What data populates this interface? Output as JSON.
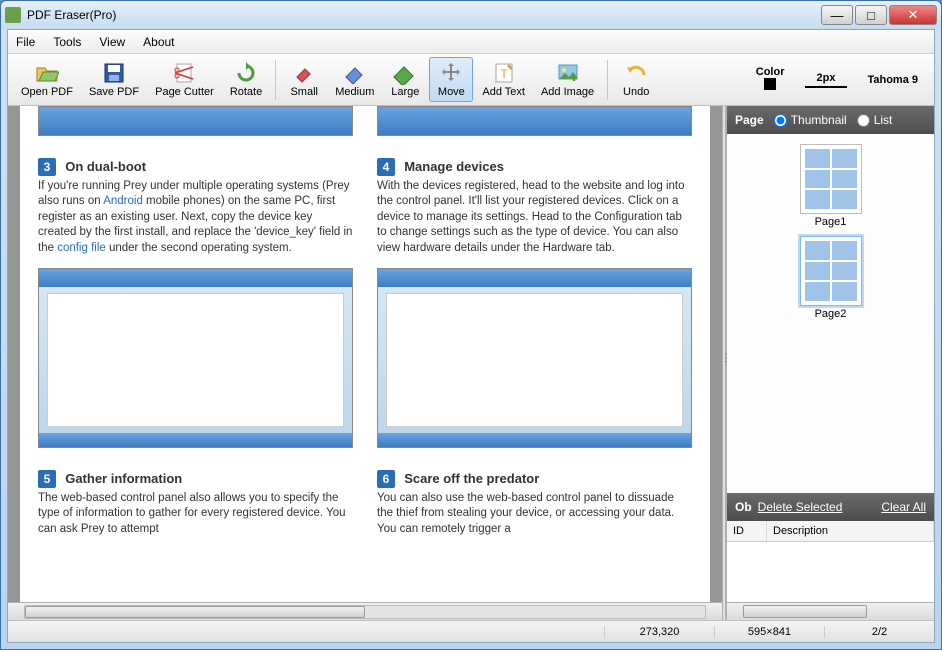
{
  "titlebar": {
    "title": "PDF Eraser(Pro)"
  },
  "menu": {
    "file": "File",
    "tools": "Tools",
    "view": "View",
    "about": "About"
  },
  "toolbar": {
    "open": "Open PDF",
    "save": "Save PDF",
    "cutter": "Page Cutter",
    "rotate": "Rotate",
    "small": "Small",
    "medium": "Medium",
    "large": "Large",
    "move": "Move",
    "addtext": "Add Text",
    "addimage": "Add Image",
    "undo": "Undo",
    "color_label": "Color",
    "px_label": "2px",
    "font_label": "Tahoma 9"
  },
  "doc": {
    "step3": {
      "num": "3",
      "title": "On dual-boot",
      "body": "If you're running Prey under multiple operating systems (Prey also runs on Android mobile phones) on the same PC, first register as an existing user. Next, copy the device key created by the first install, and replace the 'device_key' field in the config file under the second operating system.",
      "link1": "Android",
      "link2": "config file"
    },
    "step4": {
      "num": "4",
      "title": "Manage devices",
      "body": "With the devices registered, head to the website and log into the control panel. It'll list your registered devices. Click on a device to manage its settings. Head to the Configuration tab to change settings such as the type of device. You can also view hardware details under the Hardware tab."
    },
    "step5": {
      "num": "5",
      "title": "Gather information",
      "body": "The web-based control panel also allows you to specify the type of information to gather for every registered device. You can ask Prey to attempt"
    },
    "step6": {
      "num": "6",
      "title": "Scare off the predator",
      "body": "You can also use the web-based control panel to dissuade the thief from stealing your device, or accessing your data. You can remotely trigger a"
    }
  },
  "side": {
    "page_label": "Page",
    "thumb_label": "Thumbnail",
    "list_label": "List",
    "pages": [
      "Page1",
      "Page2"
    ],
    "obj_label_short": "Ob",
    "delete_selected": "Delete Selected",
    "clear_all": "Clear All",
    "col_id": "ID",
    "col_desc": "Description"
  },
  "status": {
    "coords": "273,320",
    "dims": "595×841",
    "page_of": "2/2"
  }
}
